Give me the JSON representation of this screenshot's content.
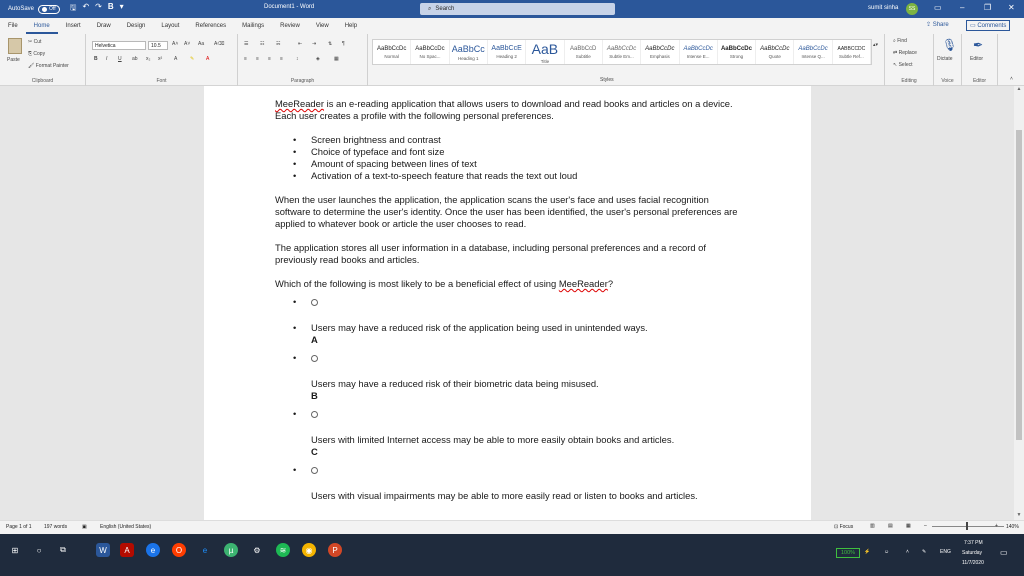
{
  "titlebar": {
    "autosave_label": "AutoSave",
    "autosave_state": "Off",
    "doc_title": "Document1 - Word",
    "search_placeholder": "Search",
    "user_name": "sumit sinha",
    "user_initials": "SS"
  },
  "menu": {
    "tabs": [
      "File",
      "Home",
      "Insert",
      "Draw",
      "Design",
      "Layout",
      "References",
      "Mailings",
      "Review",
      "View",
      "Help"
    ],
    "active": "Home",
    "share": "Share",
    "comments": "Comments"
  },
  "ribbon": {
    "clipboard": {
      "label": "Clipboard",
      "paste": "Paste",
      "cut": "Cut",
      "copy": "Copy",
      "format_painter": "Format Painter"
    },
    "font": {
      "label": "Font",
      "name": "Helvetica",
      "size": "10.5"
    },
    "paragraph": {
      "label": "Paragraph"
    },
    "styles": {
      "label": "Styles",
      "items": [
        {
          "sample": "AaBbCcDc",
          "name": "Normal"
        },
        {
          "sample": "AaBbCcDc",
          "name": "No Spac..."
        },
        {
          "sample": "AaBbCc",
          "name": "Heading 1"
        },
        {
          "sample": "AaBbCcE",
          "name": "Heading 2"
        },
        {
          "sample": "AaB",
          "name": "Title"
        },
        {
          "sample": "AaBbCcD",
          "name": "Subtitle"
        },
        {
          "sample": "AaBbCcDc",
          "name": "Subtle Em..."
        },
        {
          "sample": "AaBbCcDc",
          "name": "Emphasis"
        },
        {
          "sample": "AaBbCcDc",
          "name": "Intense E..."
        },
        {
          "sample": "AaBbCcDc",
          "name": "Strong"
        },
        {
          "sample": "AaBbCcDc",
          "name": "Quote"
        },
        {
          "sample": "AaBbCcDc",
          "name": "Intense Q..."
        },
        {
          "sample": "AABBCCDC",
          "name": "Subtle Ref..."
        }
      ]
    },
    "editing": {
      "label": "Editing",
      "find": "Find",
      "replace": "Replace",
      "select": "Select"
    },
    "voice": {
      "label": "Voice",
      "dictate": "Dictate"
    },
    "editor": {
      "label": "Editor",
      "editor": "Editor"
    }
  },
  "document": {
    "intro_lead": "MeeReader",
    "intro_rest": " is an e-reading application that allows users to download and read books and articles on a device. Each user creates a profile with the following personal preferences.",
    "preferences": [
      "Screen brightness and contrast",
      "Choice of typeface and font size",
      "Amount of spacing between lines of text",
      "Activation of a text-to-speech feature that reads the text out loud"
    ],
    "para2": "When the user launches the application, the application scans the user's face and uses facial recognition software to determine the user's identity. Once the user has been identified, the user's personal preferences are applied to whatever book or article the user chooses to read.",
    "para3": "The application stores all user information in a database, including personal preferences and a record of previously read books and articles.",
    "question_lead": "Which of the following is most likely to be a beneficial effect of using ",
    "question_app": "MeeReader",
    "question_end": "?",
    "options": [
      {
        "text": "Users may have a reduced risk of the application being used in unintended ways.",
        "letter": "A"
      },
      {
        "text": "Users may have a reduced risk of their biometric data being misused.",
        "letter": "B"
      },
      {
        "text": "Users with limited Internet access may be able to more easily obtain books and articles.",
        "letter": "C"
      },
      {
        "text": "Users with visual impairments may be able to more easily read or listen to books and articles.",
        "letter": ""
      }
    ]
  },
  "status": {
    "page": "Page 1 of 1",
    "words": "197 words",
    "language": "English (United States)",
    "focus": "Focus",
    "zoom": "140%"
  },
  "taskbar": {
    "battery": "100%",
    "lang": "ENG",
    "time": "7:37 PM",
    "day": "Saturday",
    "date": "11/7/2020"
  }
}
